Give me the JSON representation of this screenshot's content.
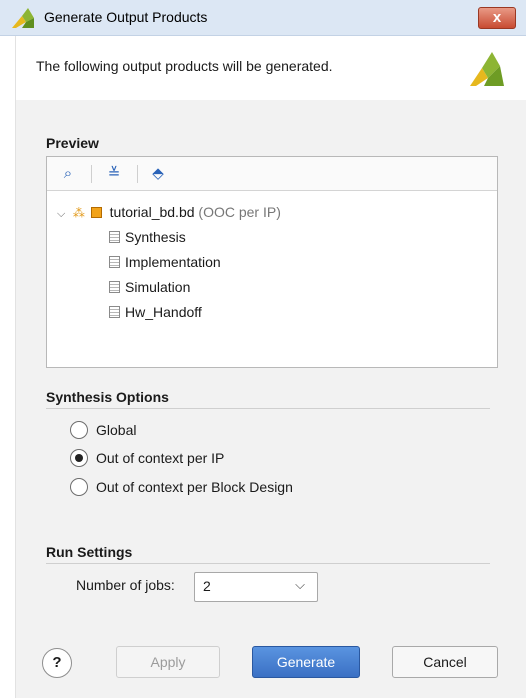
{
  "window": {
    "title": "Generate Output Products",
    "close_label": "x"
  },
  "header": {
    "subtitle": "The following output products will be generated."
  },
  "preview": {
    "section_title": "Preview",
    "toolbar": {
      "search_glyph": "⌕",
      "collapse_glyph": "≚",
      "expand_glyph": "⬘"
    },
    "tree": {
      "root_label": "tutorial_bd.bd",
      "root_note": "(OOC per IP)",
      "children": [
        "Synthesis",
        "Implementation",
        "Simulation",
        "Hw_Handoff"
      ]
    }
  },
  "synthesis_options": {
    "section_title": "Synthesis Options",
    "options": [
      {
        "label": "Global",
        "selected": false
      },
      {
        "label": "Out of context per IP",
        "selected": true
      },
      {
        "label": "Out of context per Block Design",
        "selected": false
      }
    ]
  },
  "run_settings": {
    "section_title": "Run Settings",
    "jobs_label": "Number of jobs:",
    "jobs_value": "2"
  },
  "buttons": {
    "help": "?",
    "apply": "Apply",
    "generate": "Generate",
    "cancel": "Cancel"
  },
  "colors": {
    "accent": "#3a70c4",
    "brand_green": "#8db534",
    "brand_yellow": "#e6b81e"
  }
}
